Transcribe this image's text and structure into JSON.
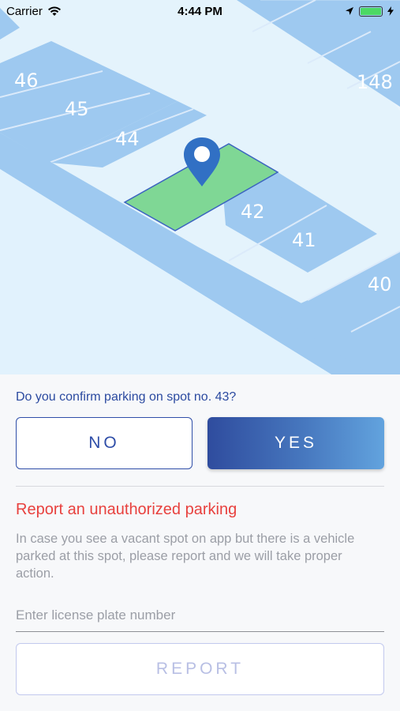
{
  "status_bar": {
    "carrier": "Carrier",
    "time": "4:44 PM",
    "battery_level": 1.0
  },
  "map": {
    "spots": {
      "s46": "46",
      "s45": "45",
      "s44": "44",
      "s42": "42",
      "s41": "41",
      "s40": "40",
      "s148": "148"
    },
    "selected_color": "#7fd795",
    "spot_color": "#9ec9f0",
    "road_color": "#e4f3fc",
    "pin_color": "#3170c4"
  },
  "confirm": {
    "question": "Do you confirm parking on spot no. 43?",
    "no_label": "NO",
    "yes_label": "YES"
  },
  "report": {
    "title": "Report an unauthorized parking",
    "description": "In case you see a vacant spot on app but there is a vehicle parked at this spot, please report and we will take proper action.",
    "plate_placeholder": "Enter license plate number",
    "button_label": "REPORT"
  }
}
